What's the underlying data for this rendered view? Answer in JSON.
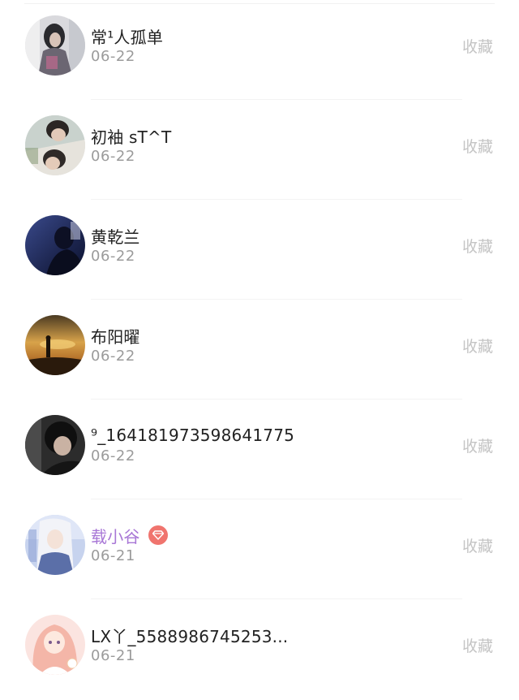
{
  "items": [
    {
      "name": "常¹人孤单",
      "date": "06-22",
      "action": "收藏",
      "vip": false,
      "avatar": "avatar-photo-girl-mirror"
    },
    {
      "name": "初袖 sT^T",
      "date": "06-22",
      "action": "收藏",
      "vip": false,
      "avatar": "avatar-photo-boys-collage"
    },
    {
      "name": "黄乾兰",
      "date": "06-22",
      "action": "收藏",
      "vip": false,
      "avatar": "avatar-photo-blue-night"
    },
    {
      "name": "布阳曜",
      "date": "06-22",
      "action": "收藏",
      "vip": false,
      "avatar": "avatar-photo-sunset-silhouette"
    },
    {
      "name": "⁹_164181973598641775",
      "date": "06-22",
      "action": "收藏",
      "vip": false,
      "avatar": "avatar-photo-dark-boy"
    },
    {
      "name": "载小谷",
      "date": "06-21",
      "action": "收藏",
      "vip": true,
      "avatar": "avatar-anime-white-hair"
    },
    {
      "name": "LX丫_5588986745253...",
      "date": "06-21",
      "action": "收藏",
      "vip": false,
      "avatar": "avatar-anime-pink-hair"
    }
  ],
  "colors": {
    "name_text": "#222222",
    "vip_name_text": "#a877d6",
    "vip_badge": "#f0746e",
    "date_text": "#9b9b9b",
    "action_text": "#c4c4c4"
  }
}
